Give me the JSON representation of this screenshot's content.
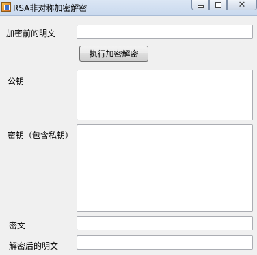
{
  "window": {
    "title": "RSA非对称加密解密",
    "close_glyph": "✕"
  },
  "form": {
    "plaintext_before_label": "加密前的明文",
    "plaintext_before_value": "",
    "execute_button_label": "执行加密解密",
    "public_key_label": "公钥",
    "public_key_value": "",
    "key_pair_label": "密钥（包含私钥）",
    "key_pair_value": "",
    "ciphertext_label": "密文",
    "ciphertext_value": "",
    "plaintext_after_label": "解密后的明文",
    "plaintext_after_value": ""
  },
  "icons": {
    "app": "app-icon",
    "minimize": "minimize-icon",
    "maximize": "maximize-icon",
    "close": "close-icon"
  }
}
